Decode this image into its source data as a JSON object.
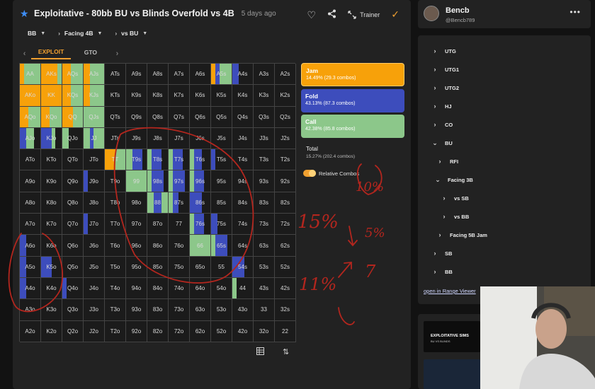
{
  "header": {
    "title": "Exploitative - 80bb BU vs Blinds Overfold vs 4B",
    "subtitle": "5 days ago",
    "trainer_label": "Trainer",
    "breadcrumbs": [
      {
        "label": "BB"
      },
      {
        "label": "Facing 4B"
      },
      {
        "label": "vs BU"
      }
    ]
  },
  "tabs": [
    {
      "label": "EXPLOIT",
      "active": true
    },
    {
      "label": "GTO",
      "active": false
    }
  ],
  "colors": {
    "jam": "#f7a10a",
    "fold": "#3d4dbc",
    "call": "#8cc78a",
    "accent": "#f0a030",
    "annotation": "#b3261e"
  },
  "hands": [
    [
      "AA",
      "AKs",
      "AQs",
      "AJs",
      "ATs",
      "A9s",
      "A8s",
      "A7s",
      "A6s",
      "A5s",
      "A4s",
      "A3s",
      "A2s"
    ],
    [
      "AKo",
      "KK",
      "KQs",
      "KJs",
      "KTs",
      "K9s",
      "K8s",
      "K7s",
      "K6s",
      "K5s",
      "K4s",
      "K3s",
      "K2s"
    ],
    [
      "AQo",
      "KQo",
      "QQ",
      "QJs",
      "QTs",
      "Q9s",
      "Q8s",
      "Q7s",
      "Q6s",
      "Q5s",
      "Q4s",
      "Q3s",
      "Q2s"
    ],
    [
      "AJo",
      "KJo",
      "QJo",
      "JJ",
      "JTs",
      "J9s",
      "J8s",
      "J7s",
      "J6s",
      "J5s",
      "J4s",
      "J3s",
      "J2s"
    ],
    [
      "ATo",
      "KTo",
      "QTo",
      "JTo",
      "TT",
      "T9s",
      "T8s",
      "T7s",
      "T6s",
      "T5s",
      "T4s",
      "T3s",
      "T2s"
    ],
    [
      "A9o",
      "K9o",
      "Q9o",
      "J9o",
      "T9o",
      "99",
      "98s",
      "97s",
      "96s",
      "95s",
      "94s",
      "93s",
      "92s"
    ],
    [
      "A8o",
      "K8o",
      "Q8o",
      "J8o",
      "T8o",
      "98o",
      "88",
      "87s",
      "86s",
      "85s",
      "84s",
      "83s",
      "82s"
    ],
    [
      "A7o",
      "K7o",
      "Q7o",
      "J7o",
      "T7o",
      "97o",
      "87o",
      "77",
      "76s",
      "75s",
      "74s",
      "73s",
      "72s"
    ],
    [
      "A6o",
      "K6o",
      "Q6o",
      "J6o",
      "T6o",
      "96o",
      "86o",
      "76o",
      "66",
      "65s",
      "64s",
      "63s",
      "62s"
    ],
    [
      "A5o",
      "K5o",
      "Q5o",
      "J5o",
      "T5o",
      "95o",
      "85o",
      "75o",
      "65o",
      "55",
      "54s",
      "53s",
      "52s"
    ],
    [
      "A4o",
      "K4o",
      "Q4o",
      "J4o",
      "T4o",
      "94o",
      "84o",
      "74o",
      "64o",
      "54o",
      "44",
      "43s",
      "42s"
    ],
    [
      "A3o",
      "K3o",
      "Q3o",
      "J3o",
      "T3o",
      "93o",
      "83o",
      "73o",
      "63o",
      "53o",
      "43o",
      "33",
      "32s"
    ],
    [
      "A2o",
      "K2o",
      "Q2o",
      "J2o",
      "T2o",
      "92o",
      "82o",
      "72o",
      "62o",
      "52o",
      "42o",
      "32o",
      "22"
    ]
  ],
  "actions": {
    "jam": {
      "name": "Jam",
      "value": "14.49% (29.3 combos)"
    },
    "fold": {
      "name": "Fold",
      "value": "43.13% (87.3 combos)"
    },
    "call": {
      "name": "Call",
      "value": "42.38% (85.8 combos)"
    }
  },
  "total": {
    "label": "Total",
    "value": "15.27% (202.4 combos)"
  },
  "relative_combos_label": "Relative Combos",
  "annotations": {
    "a1": "15%",
    "a2": "10%",
    "a3": "5%",
    "a4": "11%",
    "a5": "7"
  },
  "user": {
    "name": "Bencb",
    "handle": "@Bencb789"
  },
  "tree": [
    {
      "label": "UTG",
      "chev": "›"
    },
    {
      "label": "UTG1",
      "chev": "›"
    },
    {
      "label": "UTG2",
      "chev": "›"
    },
    {
      "label": "HJ",
      "chev": "›"
    },
    {
      "label": "CO",
      "chev": "›"
    },
    {
      "label": "BU",
      "chev": "⌄"
    },
    {
      "label": "RFI",
      "chev": "›"
    },
    {
      "label": "Facing 3B",
      "chev": "⌄"
    },
    {
      "label": "vs SB",
      "chev": "›"
    },
    {
      "label": "vs BB",
      "chev": "›"
    },
    {
      "label": "Facing 5B Jam",
      "chev": "›"
    },
    {
      "label": "SB",
      "chev": "›"
    },
    {
      "label": "BB",
      "chev": "›"
    }
  ],
  "open_link": "open in Range Viewer",
  "thumbnail": {
    "title": "EXPLOITATIVE SIMS",
    "subtitle": "BU VS BLINDS"
  }
}
